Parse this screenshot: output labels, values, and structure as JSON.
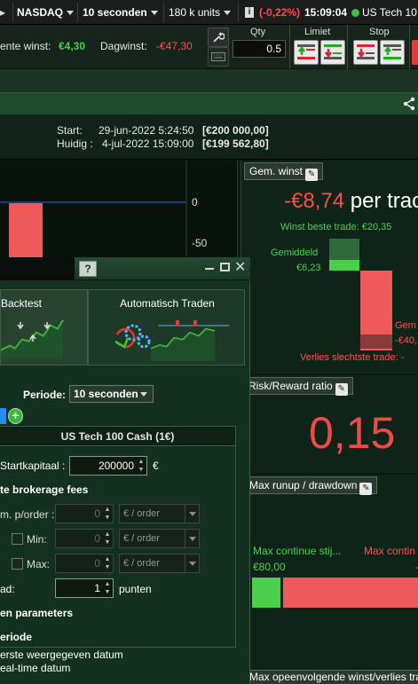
{
  "topbar": {
    "exchange": "NASDAQ",
    "timeframe": "10 seconden",
    "units": "180 k units",
    "info_icon": "info-icon",
    "change": "(-0,22%)",
    "time": "15:09:04",
    "instrument": "US Tech 10"
  },
  "gains": {
    "open_label": "ente winst:",
    "open_value": "€4,30",
    "day_label": "Dagwinst:",
    "day_value": "-€47,30"
  },
  "order_bar": {
    "qty_label": "Qty",
    "qty_value": "0.5",
    "limit_label": "Limiet",
    "stop_label": "Stop"
  },
  "info": {
    "start_label": "Start:",
    "start_date": "29-jun-2022 5:24:50",
    "start_capital": "[€200 000,00]",
    "now_label": "Huidig :",
    "now_date": "4-jul-2022 15:09:00",
    "now_capital": "[€199 562,80]"
  },
  "chart": {
    "tick_0": "0",
    "tick_neg50": "-50"
  },
  "chart_data": {
    "type": "bar",
    "ticks": [
      "0",
      "-50"
    ]
  },
  "avg_gain": {
    "title": "Gem. winst",
    "value_amount": "-€8,74",
    "value_suffix": "per trac",
    "best_trade": "Winst beste trade: €20,35",
    "avg_label": "Gemiddeld",
    "avg_value": "€6,23",
    "loss_label": "Gem",
    "loss_value": "-€40,",
    "worst_trade": "Verlies slechtste trade: -"
  },
  "risk_reward": {
    "title": "Risk/Reward ratio",
    "value": "0,15"
  },
  "runup": {
    "title": "Max runup / drawdown",
    "left_label": "Max continue stij...",
    "left_value": "€80,00",
    "right_label": "Max contin",
    "right_value": "-"
  },
  "bottom_panel": {
    "title": "Max opeenvolgende winst/verlies tra"
  },
  "dialog": {
    "help_icon": "help-icon",
    "tab_backtest": "Backtest",
    "tab_auto": "Automatisch Traden",
    "period_label": "Periode:",
    "period_value": "10 seconden",
    "instrument_header": "US Tech 100 Cash (1€)",
    "capital_label": "Startkapitaal :",
    "capital_value": "200000",
    "capital_unit": "€",
    "fees_title": "te brokerage fees",
    "fee_label": "m. p/order :",
    "fee_value": "0",
    "fee_unit": "€ / order",
    "min_label": "Min:",
    "min_value": "0",
    "min_unit": "€ / order",
    "max_label": "Max:",
    "max_value": "0",
    "max_unit": "€ / order",
    "spread_label": "ad:",
    "spread_value": "1",
    "spread_unit": "punten",
    "params_title": "en parameters",
    "period_title": "eriode",
    "option_first": "erste weergegeven datum",
    "option_realtime": "eal-time datum"
  }
}
